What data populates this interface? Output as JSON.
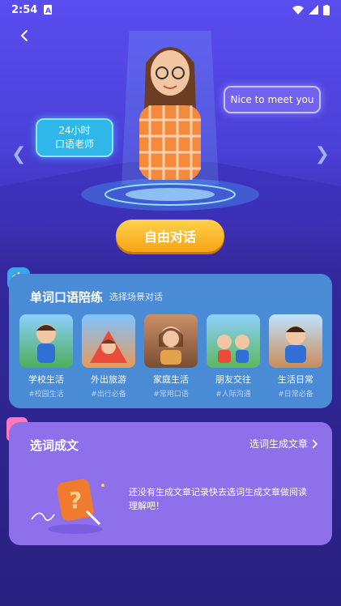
{
  "status": {
    "time": "2:54"
  },
  "hero": {
    "tag_left": "24小时\n口语老师",
    "tag_right": "Nice to meet you",
    "cta": "自由对话"
  },
  "words_practice": {
    "title": "单词口语陪练",
    "subtitle": "选择场景对话",
    "scenes": [
      {
        "name": "学校生活",
        "tag": "#校园生活"
      },
      {
        "name": "外出旅游",
        "tag": "#出行必备"
      },
      {
        "name": "家庭生活",
        "tag": "#常用口语"
      },
      {
        "name": "朋友交往",
        "tag": "#人际沟通"
      },
      {
        "name": "生活日常",
        "tag": "#日常必备"
      }
    ]
  },
  "compose": {
    "title": "选词成文",
    "link": "选词生成文章",
    "empty": "还没有生成文章记录快去选词生成文章做阅读理解吧！"
  },
  "colors": {
    "accent": "#f5a417",
    "card_blue": "#4a8bd6",
    "card_purple": "#8d70ea"
  }
}
